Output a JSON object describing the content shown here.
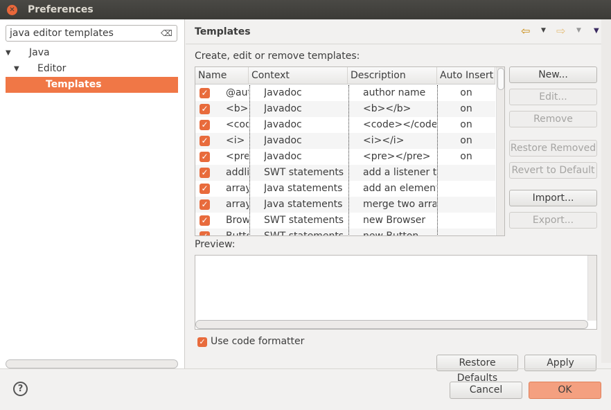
{
  "window": {
    "title": "Preferences"
  },
  "left": {
    "search_value": "java editor templates",
    "tree": [
      {
        "label": "Java"
      },
      {
        "label": "Editor"
      },
      {
        "label": "Templates"
      }
    ]
  },
  "page": {
    "title": "Templates",
    "intro": "Create, edit or remove templates:",
    "preview_label": "Preview:",
    "use_formatter": "Use code formatter"
  },
  "table": {
    "columns": [
      "Name",
      "Context",
      "Description",
      "Auto Insert"
    ],
    "rows": [
      {
        "checked": true,
        "name": "@author",
        "context": "Javadoc",
        "description": "author name",
        "auto": "on"
      },
      {
        "checked": true,
        "name": "<b>",
        "context": "Javadoc",
        "description": "<b></b>",
        "auto": "on"
      },
      {
        "checked": true,
        "name": "<code>",
        "context": "Javadoc",
        "description": "<code></code>",
        "auto": "on"
      },
      {
        "checked": true,
        "name": "<i>",
        "context": "Javadoc",
        "description": "<i></i>",
        "auto": "on"
      },
      {
        "checked": true,
        "name": "<pre>",
        "context": "Javadoc",
        "description": "<pre></pre>",
        "auto": "on"
      },
      {
        "checked": true,
        "name": "addlistener",
        "context": "SWT statements",
        "description": "add a listener to",
        "auto": ""
      },
      {
        "checked": true,
        "name": "array_add",
        "context": "Java statements",
        "description": "add an element",
        "auto": ""
      },
      {
        "checked": true,
        "name": "array_merge",
        "context": "Java statements",
        "description": "merge two arrays",
        "auto": ""
      },
      {
        "checked": true,
        "name": "Browser",
        "context": "SWT statements",
        "description": "new Browser",
        "auto": ""
      },
      {
        "checked": true,
        "name": "Button",
        "context": "SWT statements",
        "description": "new Button",
        "auto": ""
      }
    ]
  },
  "buttons": {
    "new": "New...",
    "edit": "Edit...",
    "remove": "Remove",
    "restore_removed": "Restore Removed",
    "revert": "Revert to Default",
    "import": "Import...",
    "export": "Export...",
    "restore_defaults": "Restore Defaults",
    "apply": "Apply",
    "cancel": "Cancel",
    "ok": "OK"
  },
  "colors": {
    "accent": "#f07746"
  }
}
